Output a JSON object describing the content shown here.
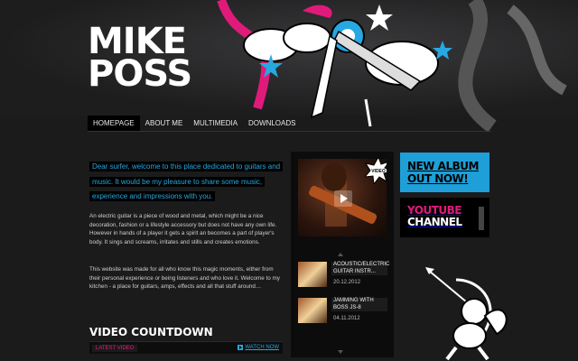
{
  "logo": {
    "line1": "MIKE",
    "line2": "POSS"
  },
  "nav": {
    "items": [
      {
        "label": "HOMEPAGE",
        "active": true
      },
      {
        "label": "ABOUT ME",
        "active": false
      },
      {
        "label": "MULTIMEDIA",
        "active": false
      },
      {
        "label": "DOWNLOADS",
        "active": false
      }
    ]
  },
  "intro": "Dear surfer, welcome to this place dedicated to guitars and music. It would be my pleasure to share some music, experience and impressions with you.",
  "paragraphs": [
    "An electric guitar is a piece of wood and metal, which might be a nice decoration, fashion or a lifestyle accessory but does not have any own life. However in hands of a player it gets a spirit an becomes a part of player's body. It sings and screams, irritates and stills and creates emotions.",
    "This website was made for all who know this magic moments, either from their personal experience or being listeners and who love it. Welcome to my kitchen - a place for guitars, amps, effects and all that stuff around…"
  ],
  "video_countdown": {
    "title": "VIDEO COUNTDOWN",
    "latest_label": "LATEST VIDEO",
    "watch_label": "WATCH NOW"
  },
  "video_player": {
    "badge": "VIDEO"
  },
  "videos": [
    {
      "title": "ACOUSTIC/ELECTRIC GUITAR INSTR...",
      "date": "20.12.2012"
    },
    {
      "title": "JAMMING WITH BOSS JS-8",
      "date": "04.11.2012"
    }
  ],
  "promos": {
    "album_line1": "NEW ALBUM",
    "album_line2": "OUT NOW!",
    "youtube_line1": "YOUTUBE",
    "youtube_line2": "CHANNEL"
  },
  "colors": {
    "accent_blue": "#1e9fd7",
    "accent_pink": "#e01a7b",
    "background": "#1b1b1c"
  }
}
